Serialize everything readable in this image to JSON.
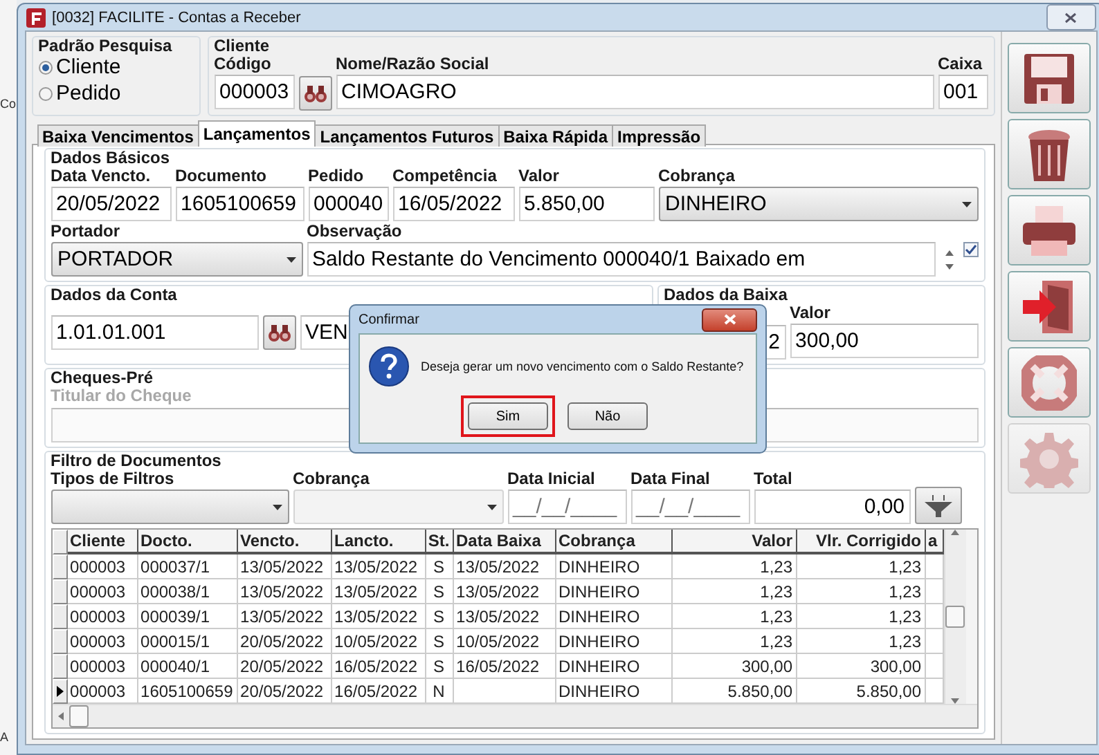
{
  "background_app": {
    "texts": [
      "Co",
      "A"
    ]
  },
  "window": {
    "title": "[0032] FACILITE - Contas a Receber"
  },
  "search_mode": {
    "title": "Padrão Pesquisa",
    "options": [
      {
        "label": "Cliente",
        "selected": true
      },
      {
        "label": "Pedido",
        "selected": false
      }
    ]
  },
  "cliente": {
    "title": "Cliente",
    "codigo_label": "Código",
    "codigo": "000003",
    "nome_label": "Nome/Razão Social",
    "nome": "CIMOAGRO",
    "caixa_label": "Caixa",
    "caixa": "001"
  },
  "tabs": [
    {
      "label": "Baixa Vencimentos",
      "selected": false
    },
    {
      "label": "Lançamentos",
      "selected": true
    },
    {
      "label": "Lançamentos Futuros",
      "selected": false
    },
    {
      "label": "Baixa Rápida",
      "selected": false
    },
    {
      "label": "Impressão",
      "selected": false
    }
  ],
  "dados_basicos": {
    "title": "Dados Básicos",
    "fields": [
      {
        "label": "Data Vencto.",
        "value": "20/05/2022",
        "kind": "text"
      },
      {
        "label": "Documento",
        "value": "1605100659",
        "kind": "text"
      },
      {
        "label": "Pedido",
        "value": "000040",
        "kind": "text"
      },
      {
        "label": "Competência",
        "value": "16/05/2022",
        "kind": "text"
      },
      {
        "label": "Valor",
        "value": "5.850,00",
        "kind": "text"
      },
      {
        "label": "Cobrança",
        "value": "DINHEIRO",
        "kind": "combo"
      }
    ],
    "portador_label": "Portador",
    "portador": "PORTADOR",
    "observacao_label": "Observação",
    "observacao": "Saldo Restante do Vencimento 000040/1 Baixado em",
    "observacao_checked": true
  },
  "dados_conta": {
    "title": "Dados da Conta",
    "conta": "1.01.01.001",
    "descricao": "VEN"
  },
  "dados_baixa": {
    "title": "Dados da Baixa",
    "data": "2",
    "valor_label": "Valor",
    "valor": "300,00"
  },
  "cheques": {
    "title": "Cheques-Pré",
    "titular_label": "Titular do Cheque",
    "disabled": true
  },
  "filtro": {
    "title": "Filtro de Documentos",
    "tipos_label": "Tipos de Filtros",
    "cobranca_label": "Cobrança",
    "cobranca_disabled": true,
    "data_inicial_label": "Data Inicial",
    "data_inicial": "__/__/____",
    "data_final_label": "Data Final",
    "data_final": "__/__/____",
    "total_label": "Total",
    "total": "0,00"
  },
  "table": {
    "columns": [
      "Cliente",
      "Docto.",
      "Vencto.",
      "Lancto.",
      "St.",
      "Data Baixa",
      "Cobrança",
      "Valor",
      "Vlr. Corrigido",
      "a"
    ],
    "rows": [
      {
        "selected": false,
        "cells": [
          "000003",
          "000037/1",
          "13/05/2022",
          "13/05/2022",
          "S",
          "13/05/2022",
          "DINHEIRO",
          "1,23",
          "1,23"
        ]
      },
      {
        "selected": false,
        "cells": [
          "000003",
          "000038/1",
          "13/05/2022",
          "13/05/2022",
          "S",
          "13/05/2022",
          "DINHEIRO",
          "1,23",
          "1,23"
        ]
      },
      {
        "selected": false,
        "cells": [
          "000003",
          "000039/1",
          "13/05/2022",
          "13/05/2022",
          "S",
          "13/05/2022",
          "DINHEIRO",
          "1,23",
          "1,23"
        ]
      },
      {
        "selected": false,
        "cells": [
          "000003",
          "000015/1",
          "20/05/2022",
          "10/05/2022",
          "S",
          "10/05/2022",
          "DINHEIRO",
          "1,23",
          "1,23"
        ]
      },
      {
        "selected": false,
        "cells": [
          "000003",
          "000040/1",
          "20/05/2022",
          "16/05/2022",
          "S",
          "16/05/2022",
          "DINHEIRO",
          "300,00",
          "300,00"
        ]
      },
      {
        "selected": true,
        "cells": [
          "000003",
          "1605100659",
          "20/05/2022",
          "16/05/2022",
          "N",
          "",
          "DINHEIRO",
          "5.850,00",
          "5.850,00"
        ]
      }
    ]
  },
  "toolbar": [
    {
      "kind": "save",
      "disabled": false
    },
    {
      "kind": "delete",
      "disabled": false
    },
    {
      "kind": "print",
      "disabled": false
    },
    {
      "kind": "exit",
      "disabled": false
    },
    {
      "kind": "help",
      "disabled": false
    },
    {
      "kind": "settings",
      "disabled": true
    }
  ],
  "dialog": {
    "title": "Confirmar",
    "message": "Deseja gerar um novo vencimento com o Saldo Restante?",
    "buttons": [
      {
        "label": "Sim",
        "highlighted": true
      },
      {
        "label": "Não",
        "highlighted": false
      }
    ]
  }
}
